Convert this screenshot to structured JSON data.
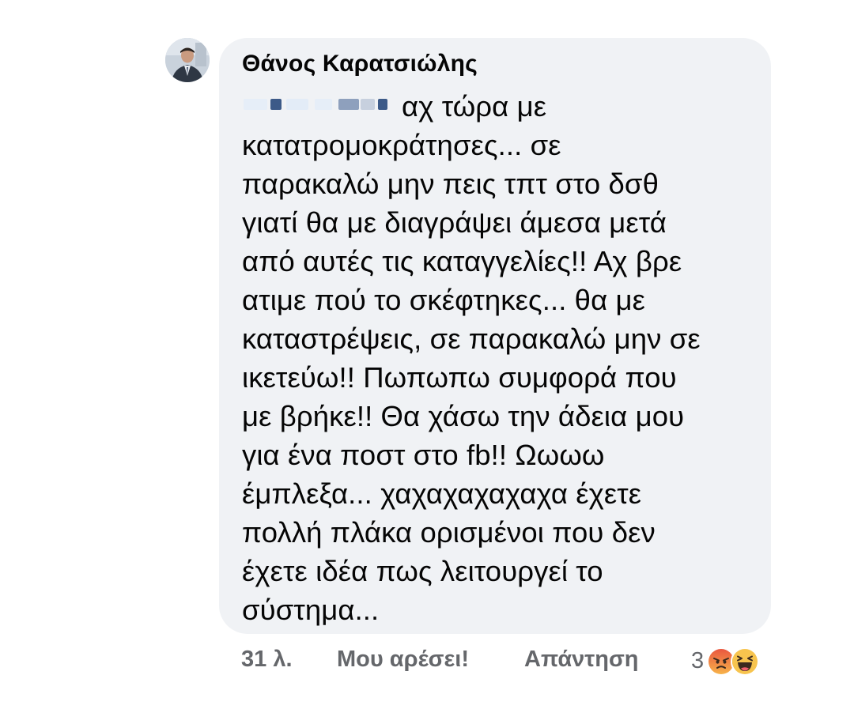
{
  "comment": {
    "author": "Θάνος Καρατσιώλης",
    "text_lines": [
      "αχ τώρα με",
      "κατατρομοκράτησες... σε",
      "παρακαλώ μην πεις τπτ στο δσθ",
      "γιατί θα με διαγράψει άμεσα μετά",
      "από αυτές τις καταγγελίες!! Αχ βρε",
      "ατιμε πού το σκέφτηκες... θα με",
      "καταστρέψεις, σε παρακαλώ μην σε",
      "ικετεύω!! Πωπωπω συμφορά που",
      "με βρήκε!! Θα χάσω την άδεια μου",
      "για ένα ποστ στο fb!! Ωωωω",
      "έμπλεξα... χαχαχαχαχαχα έχετε",
      "πολλή πλάκα ορισμένοι που δεν",
      "έχετε ιδέα πως λειτουργεί το",
      "σύστημα..."
    ],
    "mention_icon": "blurred-mention",
    "avatar_icon": "profile-photo"
  },
  "footer": {
    "time": "31 λ.",
    "like_label": "Μου αρέσει!",
    "reply_label": "Απάντηση",
    "reaction_count": "3",
    "reaction_icons": [
      "angry-emoji-icon",
      "laughing-emoji-icon"
    ]
  },
  "colors": {
    "bubble": "#f0f2f5",
    "text": "#050505",
    "secondary_text": "#65676b",
    "angry": "#f27333",
    "haha": "#f7c44e"
  }
}
